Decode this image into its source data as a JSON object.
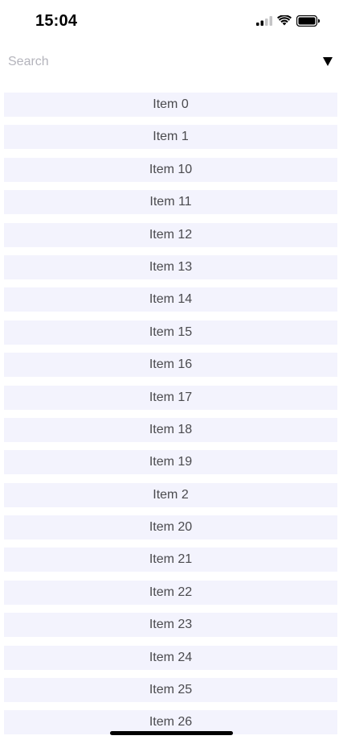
{
  "status_bar": {
    "time": "15:04",
    "icons": [
      "cellular-signal-icon",
      "wifi-icon",
      "battery-icon"
    ]
  },
  "search": {
    "placeholder": "Search",
    "value": "",
    "dropdown_icon": "caret-down-icon"
  },
  "list": {
    "items": [
      "Item 0",
      "Item 1",
      "Item 10",
      "Item 11",
      "Item 12",
      "Item 13",
      "Item 14",
      "Item 15",
      "Item 16",
      "Item 17",
      "Item 18",
      "Item 19",
      "Item 2",
      "Item 20",
      "Item 21",
      "Item 22",
      "Item 23",
      "Item 24",
      "Item 25",
      "Item 26"
    ]
  },
  "colors": {
    "item_background": "#f3f3fd",
    "item_text": "#4a4a4e",
    "placeholder": "#b4b4bc"
  }
}
